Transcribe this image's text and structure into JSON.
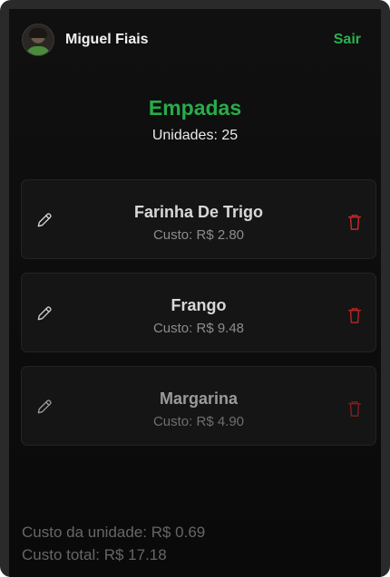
{
  "user": {
    "name": "Miguel Fiais",
    "logout_label": "Sair"
  },
  "recipe": {
    "title": "Empadas",
    "units_text": "Unidades: 25"
  },
  "ingredients": [
    {
      "name": "Farinha De Trigo",
      "cost_text": "Custo: R$ 2.80"
    },
    {
      "name": "Frango",
      "cost_text": "Custo: R$ 9.48"
    },
    {
      "name": "Margarina",
      "cost_text": "Custo: R$ 4.90"
    }
  ],
  "summary": {
    "unit_cost_text": "Custo da unidade: R$ 0.69",
    "total_cost_text": "Custo total: R$ 17.18"
  },
  "colors": {
    "accent": "#28b34b",
    "danger": "#d12b2b",
    "background": "#0e0e0e"
  }
}
